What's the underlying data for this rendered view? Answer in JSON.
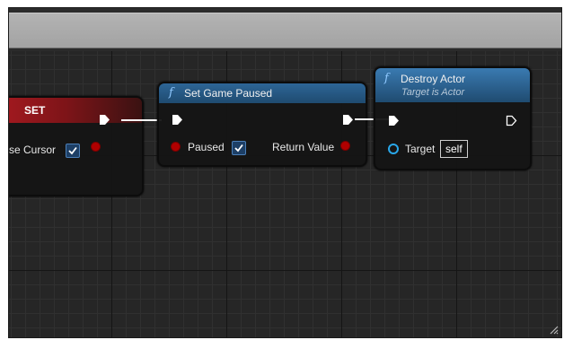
{
  "colors": {
    "set_header": "#b31b22",
    "function_header": "#1f4b70",
    "exec_pin": "#ffffff",
    "bool_pin": "#b00000",
    "object_pin": "#29a7e9",
    "checkbox": "#2d6fb3"
  },
  "set_node": {
    "title": "SET",
    "param_label": "Show Mouse Cursor",
    "param_visible_label": "se Cursor",
    "checked": true
  },
  "set_game_paused_node": {
    "title": "Set Game Paused",
    "input_label": "Paused",
    "input_checked": true,
    "output_label": "Return Value",
    "icon": "function-icon"
  },
  "destroy_actor_node": {
    "title": "Destroy Actor",
    "subtitle": "Target is Actor",
    "target_label": "Target",
    "target_value": "self",
    "icon": "function-icon"
  }
}
